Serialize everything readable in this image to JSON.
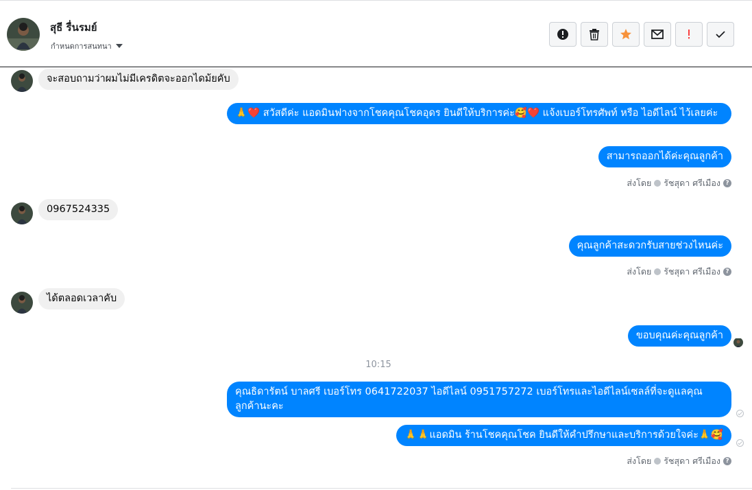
{
  "header": {
    "contact_name": "สุธี รื่นรมย์",
    "conversation_menu_label": "กำหนดการสนทนา",
    "actions": [
      {
        "name": "report-button",
        "icon": "alert-circle-icon"
      },
      {
        "name": "delete-button",
        "icon": "trash-icon"
      },
      {
        "name": "star-button",
        "icon": "star-icon"
      },
      {
        "name": "mark-unread-button",
        "icon": "envelope-icon"
      },
      {
        "name": "spam-button",
        "icon": "exclamation-icon"
      },
      {
        "name": "done-button",
        "icon": "check-icon"
      }
    ]
  },
  "messages": [
    {
      "from": "customer",
      "text": "จะสอบถามว่าผมไม่มีเครดิตจะออกไดม้ยคับ"
    },
    {
      "from": "page",
      "text": "🙏❤️ สวัสดีค่ะ แอดมินฟางจากโชคคุณโชคอุดร ยินดีให้บริการค่ะ🥰❤️ แจ้งเบอร์โทรศัพท์ หรือ ไอดีไลน์  ไว้เลยค่ะ"
    },
    {
      "from": "page",
      "text": "สามารถออกได้ค่ะคุณลูกค้า"
    },
    {
      "from": "customer",
      "text": "0967524335"
    },
    {
      "from": "page",
      "text": "คุณลูกค้าสะดวกรับสายช่วงไหนค่ะ"
    },
    {
      "from": "customer",
      "text": "ได้ตลอดเวลาคับ"
    },
    {
      "from": "page",
      "text": "ขอบคุณค่ะคุณลูกค้า"
    },
    {
      "from": "page",
      "text": "คุณธิดารัตน์ บาลศรี เบอร์โทร 0641722037  ไอดีไลน์ 0951757272  เบอร์โทรและไอดีไลน์เซลล์ที่จะดูแลคุณลูกค้านะคะ"
    },
    {
      "from": "page",
      "text": "🙏🙏แอดมิน ร้านโชคคุณโชค ยินดีให้คำปรึกษาและบริการด้วยใจค่ะ🙏🥰"
    }
  ],
  "sent_by": {
    "prefix": "ส่งโดย",
    "agent_name": "รัชสุดา ศรีเมือง",
    "help_glyph": "?"
  },
  "timestamp": "10:15",
  "colors": {
    "outgoing_bubble": "#0084ff",
    "incoming_bubble": "#f0f0f0",
    "star_accent": "#f7923b",
    "spam_accent": "#fa3e3e"
  }
}
